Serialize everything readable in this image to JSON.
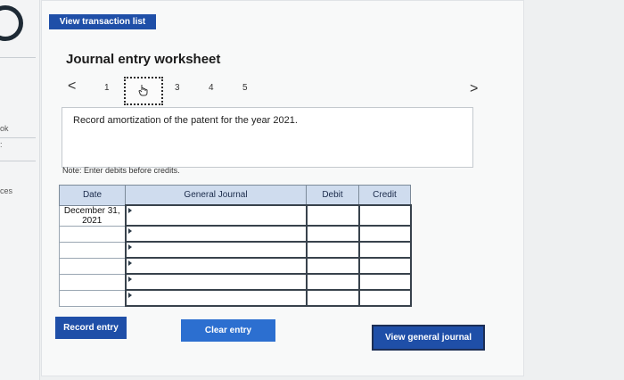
{
  "sidebar": {
    "fragment_1": "ok",
    "fragment_2": ":",
    "fragment_3": "ces"
  },
  "header": {
    "top_tab_label": "View transaction list",
    "title": "Journal entry worksheet"
  },
  "pager": {
    "prev": "<",
    "next": ">",
    "pages": [
      "1",
      "2",
      "3",
      "4",
      "5"
    ],
    "current": "2"
  },
  "instruction": "Record amortization of the patent for the year 2021.",
  "note": "Note: Enter debits before credits.",
  "table": {
    "headers": {
      "date": "Date",
      "general_journal": "General Journal",
      "debit": "Debit",
      "credit": "Credit"
    },
    "first_date": "December 31, 2021"
  },
  "buttons": {
    "record": "Record entry",
    "clear": "Clear entry",
    "view": "View general journal"
  },
  "colors": {
    "accent": "#1f4fa8",
    "header_fill": "#cfdcee"
  }
}
